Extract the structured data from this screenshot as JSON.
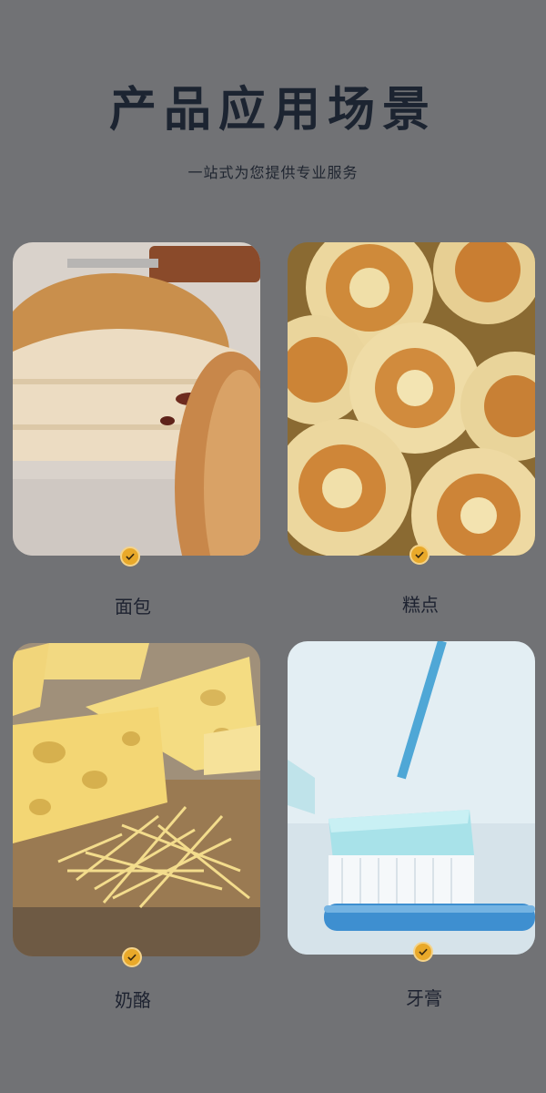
{
  "header": {
    "title": "产品应用场景",
    "subtitle": "一站式为您提供专业服务"
  },
  "scenes": [
    {
      "label": "面包"
    },
    {
      "label": "糕点"
    },
    {
      "label": "奶酪"
    },
    {
      "label": "牙膏"
    }
  ],
  "colors": {
    "background": "#717275",
    "title": "#1c2431",
    "check_badge": "#e9a92a"
  },
  "icons": [
    "check-icon"
  ]
}
